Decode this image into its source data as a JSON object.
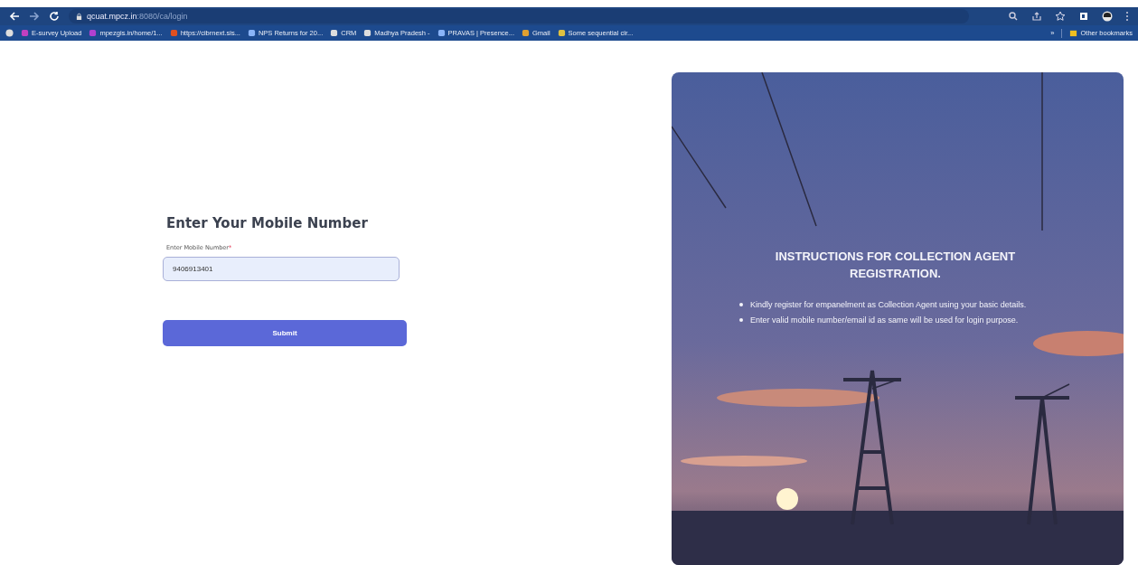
{
  "browser": {
    "url_host": "qcuat.mpcz.in",
    "url_path": ":8080/ca/login",
    "bookmarks": [
      {
        "label": "E-survey Upload",
        "color": "#c040c0"
      },
      {
        "label": "mpezgis.in/home/1...",
        "color": "#b040d0"
      },
      {
        "label": "https://cibrnext.sis...",
        "color": "#e05020"
      },
      {
        "label": "NPS Returns for 20...",
        "color": "#8ab4f8"
      },
      {
        "label": "CRM",
        "color": "#dddddd"
      },
      {
        "label": "Madhya Pradesh -",
        "color": "#dddddd"
      },
      {
        "label": "PRAVAS | Presence...",
        "color": "#8ab4f8"
      },
      {
        "label": "Gmail",
        "color": "#e0a030"
      },
      {
        "label": "Some sequential cir...",
        "color": "#e0c040"
      }
    ],
    "overflow": "»",
    "other_bookmarks": "Other bookmarks"
  },
  "form": {
    "title": "Enter Your Mobile Number",
    "field_label": "Enter Mobile Number",
    "required_mark": "*",
    "value": "9406913401",
    "button": "Submit"
  },
  "panel": {
    "title": "INSTRUCTIONS FOR COLLECTION AGENT REGISTRATION.",
    "items": [
      "Kindly register for empanelment as Collection Agent using your basic details.",
      "Enter valid mobile number/email id as same will be used for login purpose."
    ]
  }
}
